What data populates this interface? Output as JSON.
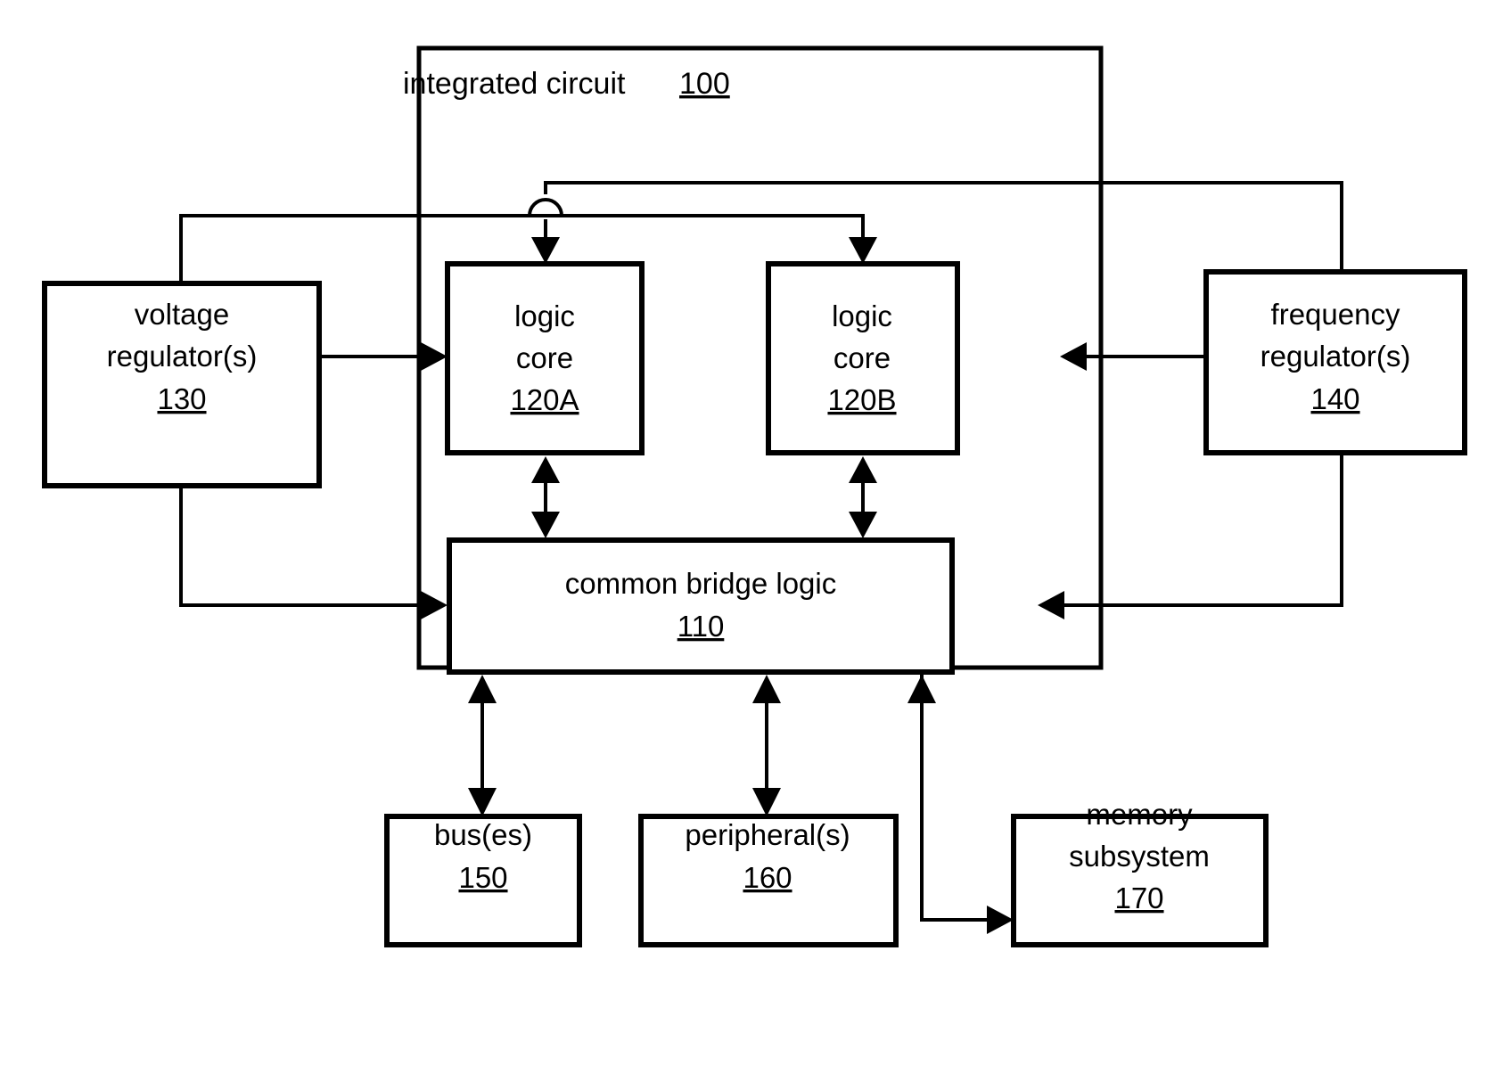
{
  "figure": {
    "kind": "patent-block-diagram",
    "background_color": "#ffffff",
    "line_color": "#000000"
  },
  "container": {
    "label": "integrated circuit",
    "ref": "100",
    "name": "integrated-circuit-boundary"
  },
  "blocks": {
    "voltage_regulator": {
      "line1": "voltage",
      "line2": "regulator(s)",
      "ref": "130"
    },
    "logic_core_a": {
      "line1": "logic",
      "line2": "core",
      "ref": "120A"
    },
    "logic_core_b": {
      "line1": "logic",
      "line2": "core",
      "ref": "120B"
    },
    "frequency_regulator": {
      "line1": "frequency",
      "line2": "regulator(s)",
      "ref": "140"
    },
    "common_bridge_logic": {
      "line1": "common bridge logic",
      "ref": "110"
    },
    "buses": {
      "line1": "bus(es)",
      "ref": "150"
    },
    "peripherals": {
      "line1": "peripheral(s)",
      "ref": "160"
    },
    "memory_subsystem": {
      "line1": "memory",
      "line2": "subsystem",
      "ref": "170"
    }
  },
  "connections": [
    {
      "id": "vr-to-core-a",
      "from": "voltage_regulator",
      "to": "logic_core_a",
      "style": "arrow-right"
    },
    {
      "id": "vr-to-core-b",
      "from": "voltage_regulator",
      "to": "logic_core_b",
      "style": "arrow-down"
    },
    {
      "id": "vr-to-bridge",
      "from": "voltage_regulator",
      "to": "common_bridge_logic",
      "style": "arrow-right"
    },
    {
      "id": "fr-to-core-b",
      "from": "frequency_regulator",
      "to": "logic_core_b",
      "style": "arrow-left"
    },
    {
      "id": "fr-to-core-a",
      "from": "frequency_regulator",
      "to": "logic_core_a",
      "style": "arrow-down"
    },
    {
      "id": "fr-to-bridge",
      "from": "frequency_regulator",
      "to": "common_bridge_logic",
      "style": "arrow-left"
    },
    {
      "id": "core-a-bridge",
      "from": "logic_core_a",
      "to": "common_bridge_logic",
      "style": "double-arrow-vertical"
    },
    {
      "id": "core-b-bridge",
      "from": "logic_core_b",
      "to": "common_bridge_logic",
      "style": "double-arrow-vertical"
    },
    {
      "id": "bridge-buses",
      "from": "common_bridge_logic",
      "to": "buses",
      "style": "double-arrow-vertical"
    },
    {
      "id": "bridge-peripherals",
      "from": "common_bridge_logic",
      "to": "peripherals",
      "style": "double-arrow-vertical"
    },
    {
      "id": "bridge-memory",
      "from": "common_bridge_logic",
      "to": "memory_subsystem",
      "style": "arrow-right"
    }
  ]
}
